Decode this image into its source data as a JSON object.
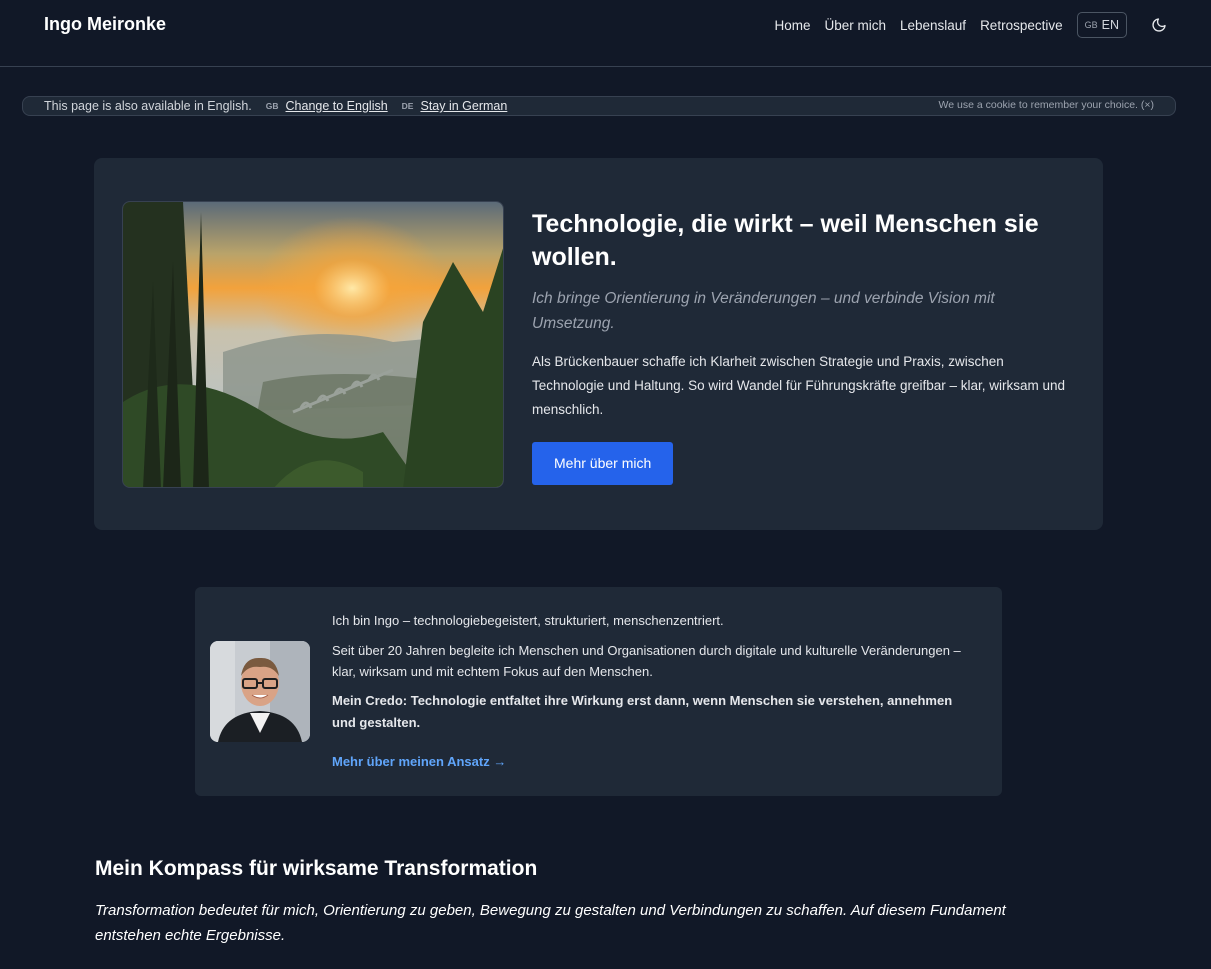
{
  "header": {
    "brand": "Ingo Meironke",
    "nav": [
      "Home",
      "Über mich",
      "Lebenslauf",
      "Retrospective"
    ],
    "lang_button": {
      "flag": "GB",
      "label": "EN"
    },
    "theme_icon": "moon-icon"
  },
  "lang_banner": {
    "message": "This page is also available in English.",
    "switch": {
      "flag": "GB",
      "label": "Change to English"
    },
    "stay": {
      "flag": "DE",
      "label": "Stay in German"
    },
    "cookie_note": "We use a cookie to remember your choice. (×)"
  },
  "hero": {
    "title": "Technologie, die wirkt – weil Menschen sie wollen.",
    "subtitle": "Ich bringe Orientierung in Veränderungen – und verbinde Vision mit Umsetzung.",
    "body": "Als Brückenbauer schaffe ich Klarheit zwischen Strategie und Praxis, zwischen Technologie und Haltung. So wird Wandel für Führungskräfte greifbar – klar, wirksam und menschlich.",
    "button": "Mehr über mich"
  },
  "about": {
    "intro": "Ich bin Ingo – technologiebegeistert, strukturiert, menschenzentriert.",
    "body": "Seit über 20 Jahren begleite ich Menschen und Organisationen durch digitale und kulturelle Veränderungen – klar, wirksam und mit echtem Fokus auf den Menschen.",
    "credo": "Mein Credo: Technologie entfaltet ihre Wirkung erst dann, wenn Menschen sie verstehen, annehmen und gestalten.",
    "link": "Mehr über meinen Ansatz →"
  },
  "compass": {
    "title": "Mein Kompass für wirksame Transformation",
    "body": "Transformation bedeutet für mich, Orientierung zu geben, Bewegung zu gestalten und Verbindungen zu schaffen. Auf diesem Fundament entstehen echte Ergebnisse."
  },
  "colors": {
    "background": "#111827",
    "card": "#1f2937",
    "accent_button": "#2563eb",
    "link": "#60a5fa"
  }
}
